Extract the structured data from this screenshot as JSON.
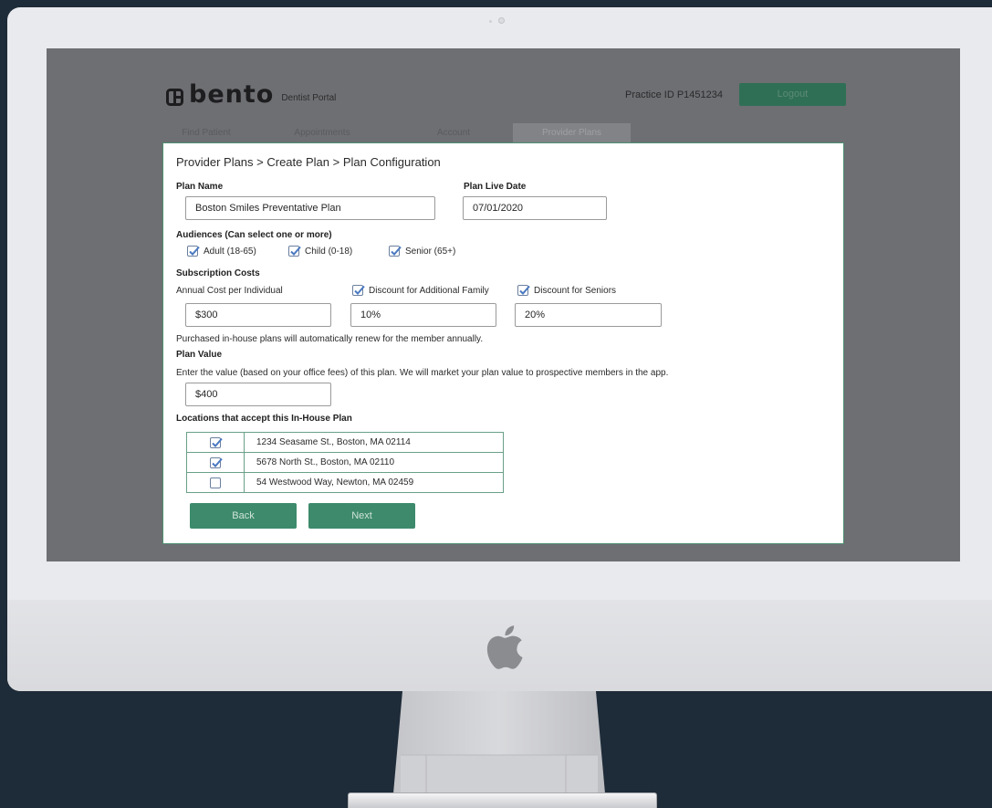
{
  "header": {
    "brand": "bento",
    "subtitle": "Dentist Portal",
    "practice_id": "Practice ID P1451234",
    "logout_label": "Logout"
  },
  "tabs": [
    {
      "label": "Find Patient"
    },
    {
      "label": "Appointments"
    },
    {
      "label": "Account"
    },
    {
      "label": "Provider Plans",
      "active": true
    }
  ],
  "form": {
    "breadcrumb": "Provider Plans > Create Plan > Plan Configuration",
    "plan_name_label": "Plan Name",
    "plan_name_value": "Boston Smiles Preventative Plan",
    "live_date_label": "Plan Live Date",
    "live_date_value": "07/01/2020",
    "audiences_label": "Audiences (Can select one or more)",
    "audiences": [
      {
        "label": "Adult (18-65)",
        "checked": true
      },
      {
        "label": "Child (0-18)",
        "checked": true
      },
      {
        "label": "Senior (65+)",
        "checked": true
      }
    ],
    "costs_label": "Subscription Costs",
    "annual_cost_label": "Annual Cost per Individual",
    "annual_cost_value": "$300",
    "family_discount_label": "Discount for Additional Family",
    "family_discount_value": "10%",
    "senior_discount_label": "Discount for Seniors",
    "senior_discount_value": "20%",
    "renew_note": "Purchased in-house plans will automatically renew for the member annually.",
    "plan_value_label": "Plan Value",
    "plan_value_note": "Enter the value (based on your office fees) of this plan. We will market your plan value to prospective members in the app.",
    "plan_value_value": "$400",
    "locations_label": "Locations that accept this In-House Plan",
    "locations": [
      {
        "address": "1234 Seasame St., Boston, MA 02114",
        "checked": true
      },
      {
        "address": "5678 North St., Boston, MA 02110",
        "checked": true
      },
      {
        "address": "54 Westwood Way, Newton, MA 02459",
        "checked": false
      }
    ],
    "back_label": "Back",
    "next_label": "Next"
  },
  "colors": {
    "accent": "#3d8a6c",
    "checkbox": "#4a79c0",
    "background": "#1e2b38"
  }
}
